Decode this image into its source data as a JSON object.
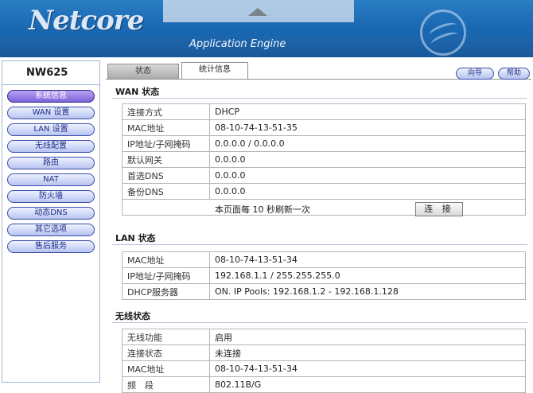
{
  "header": {
    "logo": "Netcore",
    "subtitle": "Application Engine"
  },
  "sidebar": {
    "model": "NW625",
    "items": [
      {
        "label": "系统信息",
        "active": true
      },
      {
        "label": "WAN 设置"
      },
      {
        "label": "LAN 设置"
      },
      {
        "label": "无线配置"
      },
      {
        "label": "路由"
      },
      {
        "label": "NAT"
      },
      {
        "label": "防火墙"
      },
      {
        "label": "动态DNS"
      },
      {
        "label": "其它选项"
      },
      {
        "label": "售后服务"
      }
    ]
  },
  "tabs": {
    "status": "状态",
    "stats": "统计信息"
  },
  "buttons": {
    "guide": "向导",
    "help": "帮助",
    "connect": "连 接"
  },
  "wan": {
    "title": "WAN 状态",
    "rows": [
      {
        "k": "连接方式",
        "v": "DHCP"
      },
      {
        "k": "MAC地址",
        "v": "08-10-74-13-51-35"
      },
      {
        "k": "IP地址/子网掩码",
        "v": "0.0.0.0 / 0.0.0.0"
      },
      {
        "k": "默认网关",
        "v": "0.0.0.0"
      },
      {
        "k": "首选DNS",
        "v": "0.0.0.0"
      },
      {
        "k": "备份DNS",
        "v": "0.0.0.0"
      }
    ],
    "refresh": "本页面每 10 秒刷新一次"
  },
  "lan": {
    "title": "LAN 状态",
    "rows": [
      {
        "k": "MAC地址",
        "v": "08-10-74-13-51-34"
      },
      {
        "k": "IP地址/子网掩码",
        "v": "192.168.1.1 / 255.255.255.0"
      },
      {
        "k": "DHCP服务器",
        "v": "ON. IP Pools: 192.168.1.2 - 192.168.1.128"
      }
    ]
  },
  "wireless": {
    "title": "无线状态",
    "rows": [
      {
        "k": "无线功能",
        "v": "启用"
      },
      {
        "k": "连接状态",
        "v": "未连接"
      },
      {
        "k": "MAC地址",
        "v": "08-10-74-13-51-34"
      },
      {
        "k": "频　段",
        "v": "802.11B/G"
      }
    ]
  },
  "colors": {
    "header": "#1b69b3",
    "nav_active": "#7f63d9",
    "nav_border": "#3b4fa8"
  }
}
